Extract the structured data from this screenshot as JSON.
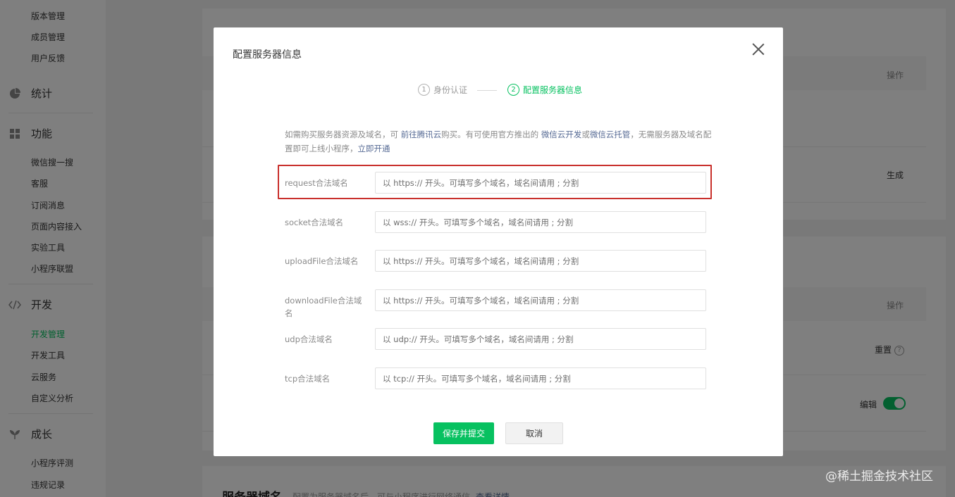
{
  "sidebar": {
    "top_items": [
      "版本管理",
      "成员管理",
      "用户反馈"
    ],
    "groups": [
      {
        "label": "统计",
        "icon": "pie-chart-icon"
      },
      {
        "label": "功能",
        "icon": "grid-icon"
      },
      {
        "label": "开发",
        "icon": "code-icon"
      },
      {
        "label": "成长",
        "icon": "sprout-icon"
      }
    ],
    "feature_items": [
      "微信搜一搜",
      "客服",
      "订阅消息",
      "页面内容接入",
      "实验工具",
      "小程序联盟"
    ],
    "dev_items": [
      "开发管理",
      "开发工具",
      "云服务",
      "自定义分析"
    ],
    "growth_items": [
      "小程序评测",
      "违规记录"
    ],
    "active_item": "开发管理"
  },
  "background": {
    "op_header_1": "操作",
    "generate_link": "生成",
    "op_header_2": "操作",
    "reset_link": "重置",
    "edit_link": "编辑",
    "toggle_state": "on",
    "section_title": "服务器域名",
    "section_subtitle": "配置为服务器域名后，可与小程序进行网络通信",
    "section_link": "查看详情"
  },
  "dialog": {
    "title": "配置服务器信息",
    "steps": [
      {
        "num": "1",
        "label": "身份认证",
        "state": "done"
      },
      {
        "num": "2",
        "label": "配置服务器信息",
        "state": "active"
      }
    ],
    "tip": {
      "part1": "如需购买服务器资源及域名，可 ",
      "link1": "前往腾讯云",
      "part2": "购买。有可使用官方推出的 ",
      "link2": "微信云开发",
      "part3": "或",
      "link3": "微信云托管",
      "part4": "，无需服务器及域名配置即可上线小程序，",
      "link4": "立即开通"
    },
    "fields": [
      {
        "label": "request合法域名",
        "placeholder": "以 https:// 开头。可填写多个域名，域名间请用 ; 分割",
        "value": ""
      },
      {
        "label": "socket合法域名",
        "placeholder": "以 wss:// 开头。可填写多个域名，域名间请用 ; 分割",
        "value": ""
      },
      {
        "label": "uploadFile合法域名",
        "placeholder": "以 https:// 开头。可填写多个域名，域名间请用 ; 分割",
        "value": ""
      },
      {
        "label": "downloadFile合法域名",
        "placeholder": "以 https:// 开头。可填写多个域名，域名间请用 ; 分割",
        "value": ""
      },
      {
        "label": "udp合法域名",
        "placeholder": "以 udp:// 开头。可填写多个域名，域名间请用 ; 分割",
        "value": ""
      },
      {
        "label": "tcp合法域名",
        "placeholder": "以 tcp:// 开头。可填写多个域名，域名间请用 ; 分割",
        "value": ""
      }
    ],
    "submit_label": "保存并提交",
    "cancel_label": "取消"
  },
  "watermark": "@稀土掘金技术社区",
  "colors": {
    "accent": "#07c160",
    "link": "#576b95",
    "highlight": "#c9302c"
  }
}
